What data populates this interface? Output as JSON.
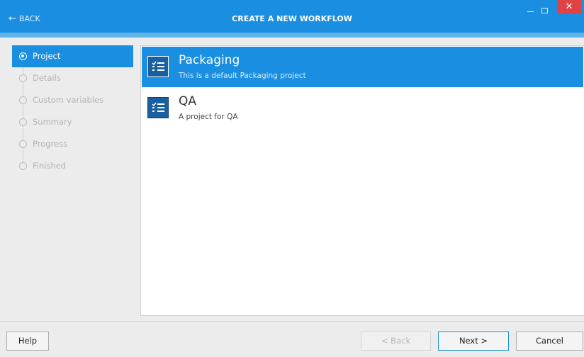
{
  "window": {
    "title": "CREATE A NEW WORKFLOW",
    "back_label": "BACK",
    "close_glyph": "✕",
    "accent_color": "#1a8ee1"
  },
  "steps": [
    {
      "label": "Project",
      "active": true
    },
    {
      "label": "Details",
      "active": false
    },
    {
      "label": "Custom variables",
      "active": false
    },
    {
      "label": "Summary",
      "active": false
    },
    {
      "label": "Progress",
      "active": false
    },
    {
      "label": "Finished",
      "active": false
    }
  ],
  "projects": [
    {
      "name": "Packaging",
      "description": "This is a default Packaging project",
      "selected": true,
      "icon": "checklist-icon"
    },
    {
      "name": "QA",
      "description": "A project for QA",
      "selected": false,
      "icon": "checklist-icon"
    }
  ],
  "footer": {
    "help_label": "Help",
    "back_label": "< Back",
    "next_label": "Next >",
    "cancel_label": "Cancel"
  }
}
